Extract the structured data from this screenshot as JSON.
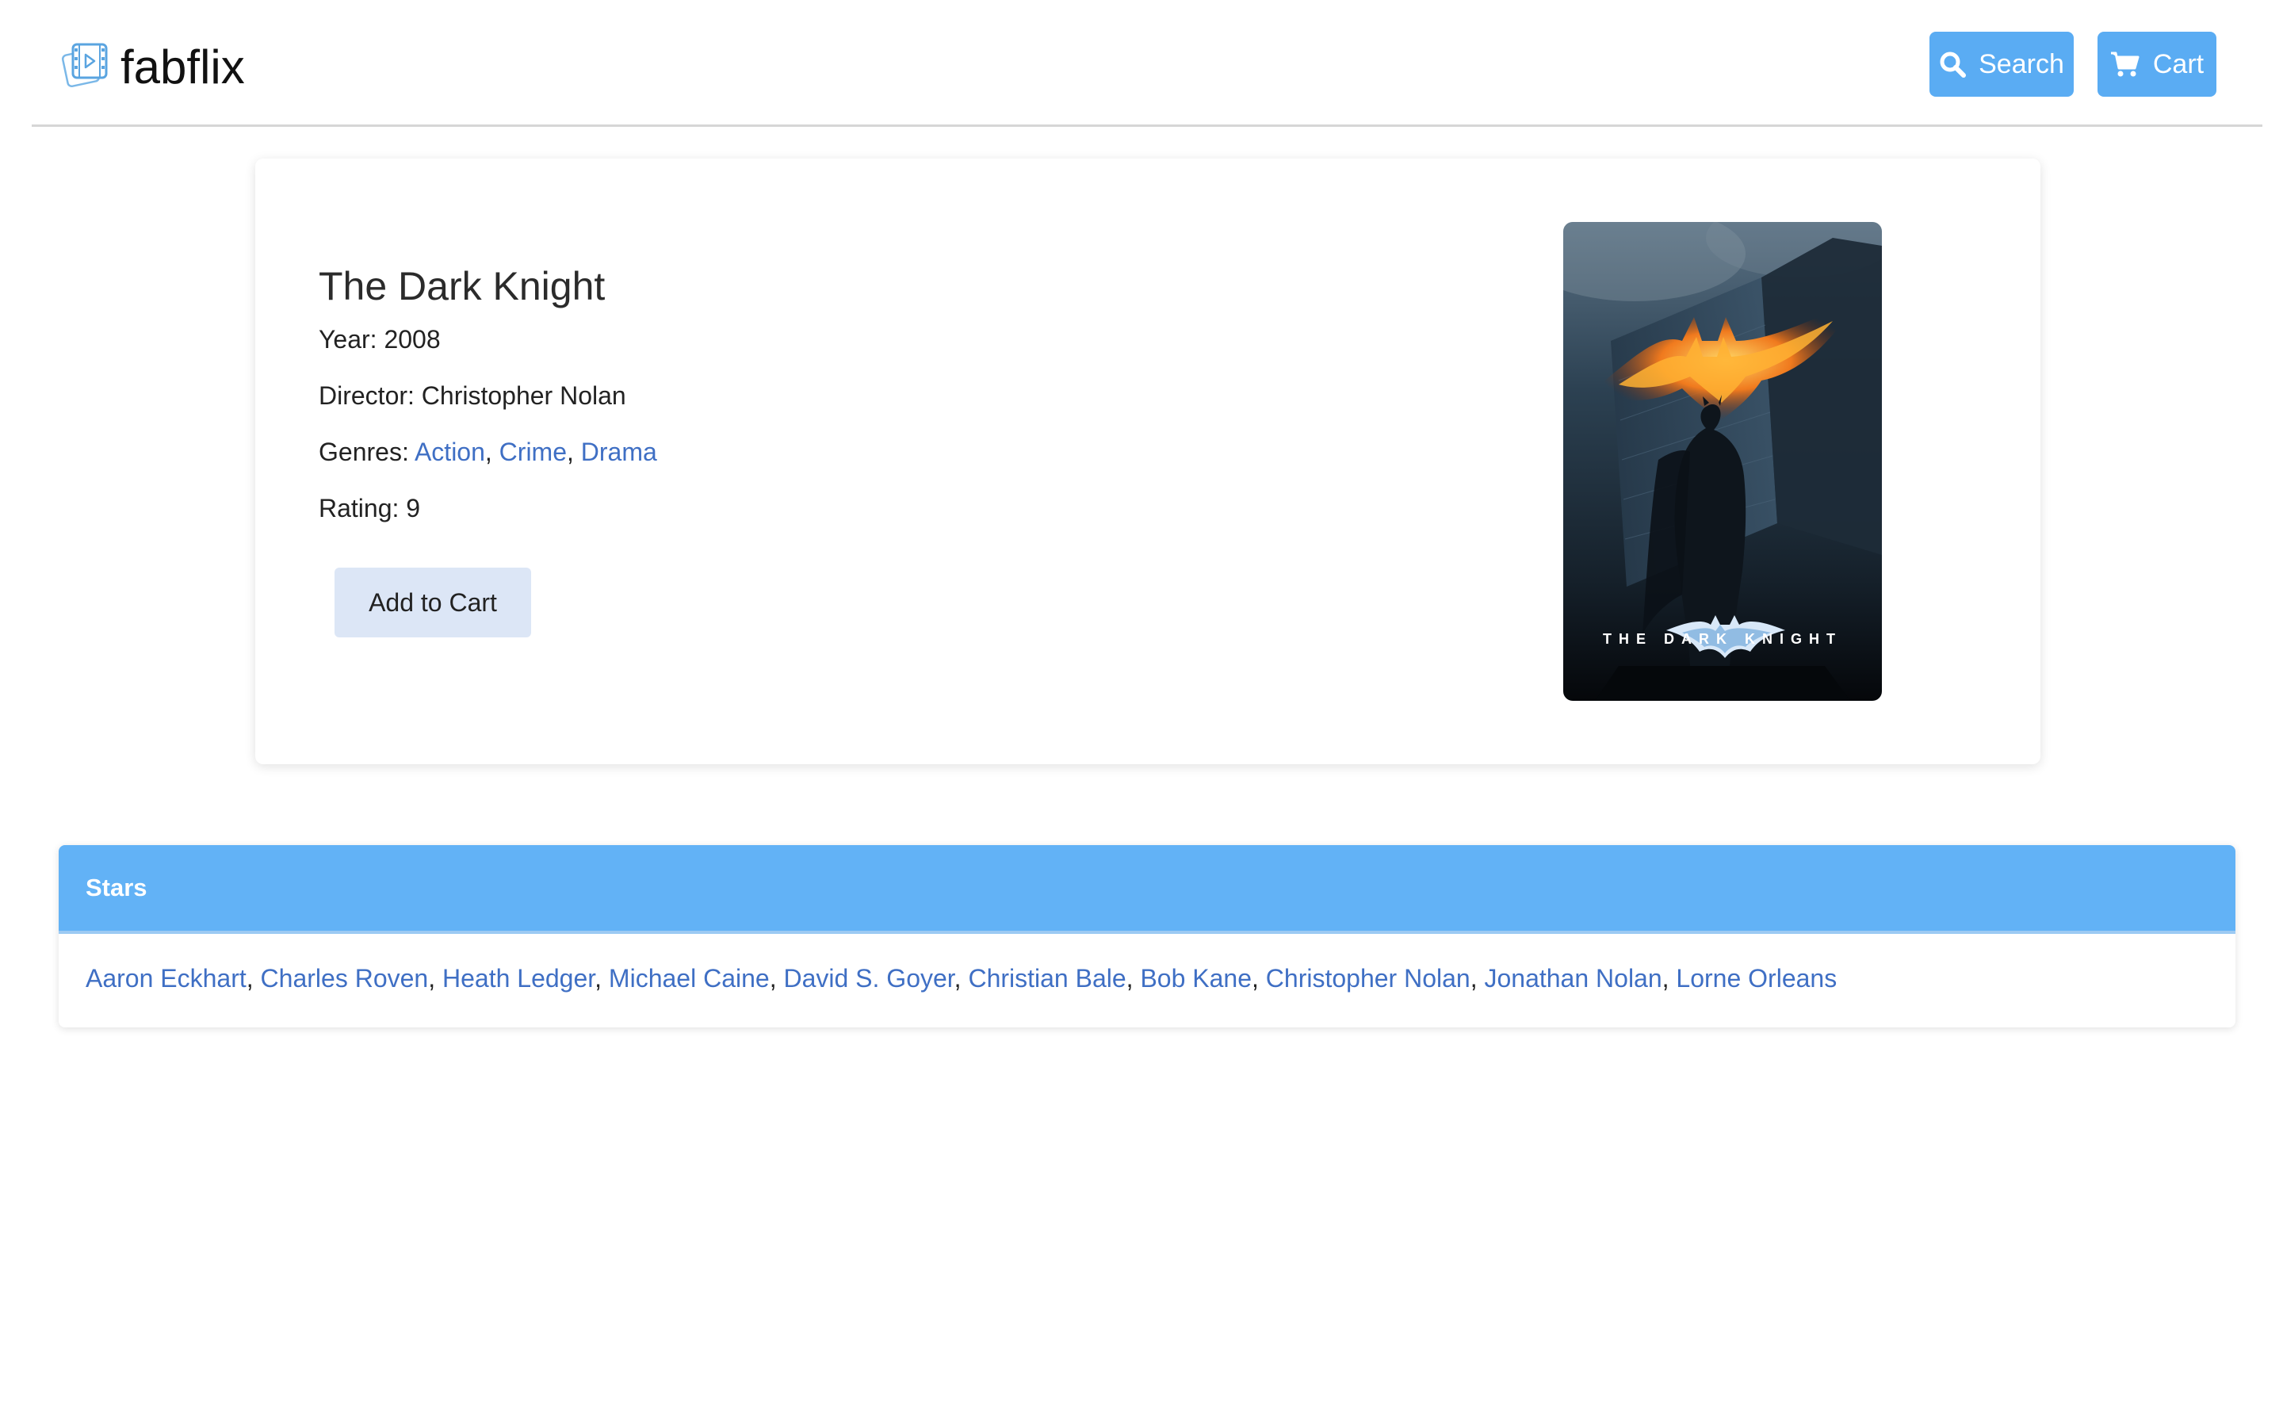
{
  "header": {
    "brand": "fabflix",
    "logo_icon": "film-icon",
    "search_label": "Search",
    "search_icon": "search-icon",
    "cart_label": "Cart",
    "cart_icon": "cart-icon",
    "button_color": "#5aacf3"
  },
  "movie": {
    "title": "The Dark Knight",
    "year_label": "Year:",
    "year": "2008",
    "director_label": "Director:",
    "director": "Christopher Nolan",
    "genres_label": "Genres:",
    "genres": [
      "Action",
      "Crime",
      "Drama"
    ],
    "rating_label": "Rating:",
    "rating": "9",
    "add_to_cart_label": "Add to Cart",
    "poster_text": "THE DARK KNIGHT"
  },
  "stars": {
    "header": "Stars",
    "header_color": "#62b2f6",
    "names": [
      "Aaron Eckhart",
      "Charles Roven",
      "Heath Ledger",
      "Michael Caine",
      "David S. Goyer",
      "Christian Bale",
      "Bob Kane",
      "Christopher Nolan",
      "Jonathan Nolan",
      "Lorne Orleans"
    ]
  },
  "colors": {
    "link": "#3f6fc4",
    "add_to_cart_bg": "#dce6f6"
  }
}
